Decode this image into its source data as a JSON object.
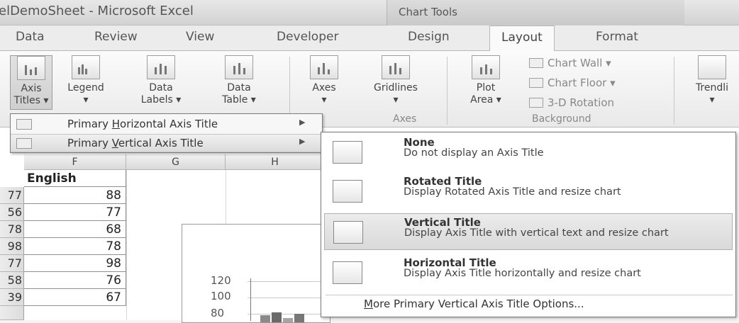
{
  "window": {
    "title": "elDemoSheet - Microsoft Excel",
    "context_tab_group": "Chart Tools"
  },
  "tabs": [
    {
      "label": "Data"
    },
    {
      "label": "Review"
    },
    {
      "label": "View"
    },
    {
      "label": "Developer"
    },
    {
      "label": "Design"
    },
    {
      "label": "Layout",
      "active": true
    },
    {
      "label": "Format"
    }
  ],
  "ribbon": {
    "labels_group": {
      "axis_titles": [
        "Axis",
        "Titles ▾"
      ],
      "legend": [
        "Legend",
        "▾"
      ],
      "data_labels": [
        "Data",
        "Labels ▾"
      ],
      "data_table": [
        "Data",
        "Table ▾"
      ]
    },
    "axes_group": {
      "label": "Axes",
      "axes": [
        "Axes",
        "▾"
      ],
      "gridlines": [
        "Gridlines",
        "▾"
      ]
    },
    "background_group": {
      "label": "Background",
      "plot_area": [
        "Plot",
        "Area ▾"
      ],
      "chart_wall": "Chart Wall ▾",
      "chart_floor": "Chart Floor ▾",
      "rotation": "3-D Rotation"
    },
    "analysis_group": {
      "trendline": [
        "Trendli",
        "▾"
      ]
    }
  },
  "axis_titles_menu": {
    "items": [
      {
        "pre": "Primary ",
        "key": "H",
        "post": "orizontal Axis Title",
        "arrow": "▶"
      },
      {
        "pre": "Primary ",
        "key": "V",
        "post": "ertical Axis Title",
        "arrow": "▶"
      }
    ]
  },
  "vertical_axis_submenu": {
    "options": [
      {
        "title": "None",
        "desc": "Do not display an Axis Title"
      },
      {
        "title": "Rotated Title",
        "desc": "Display Rotated Axis Title and resize chart"
      },
      {
        "title": "Vertical Title",
        "desc": "Display Axis Title with vertical text and resize chart"
      },
      {
        "title": "Horizontal Title",
        "desc": "Display Axis Title horizontally and resize chart"
      }
    ],
    "more_pre": "",
    "more_key": "M",
    "more_post": "ore Primary Vertical Axis Title Options..."
  },
  "sheet": {
    "columns": [
      "F",
      "G",
      "H"
    ],
    "header_cell": "English",
    "rows": [
      {
        "left": "77",
        "value": "88"
      },
      {
        "left": "56",
        "value": "77"
      },
      {
        "left": "78",
        "value": "68"
      },
      {
        "left": "98",
        "value": "78"
      },
      {
        "left": "77",
        "value": "98"
      },
      {
        "left": "58",
        "value": "76"
      },
      {
        "left": "39",
        "value": "67"
      }
    ]
  },
  "chart": {
    "ticks": [
      "120",
      "100",
      "80"
    ]
  },
  "colors": {
    "ribbon_bg": "#f4f4f4",
    "highlight": "#dcdcdc",
    "border": "#7d7d7d"
  }
}
